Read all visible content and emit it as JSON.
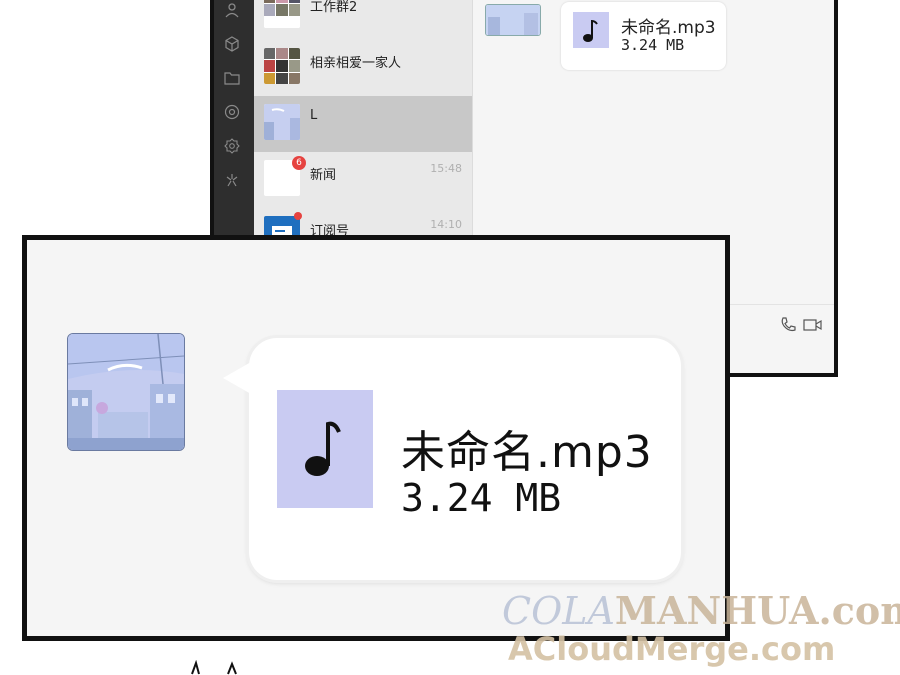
{
  "chat_list": [
    {
      "name": "工作群2",
      "time": "",
      "badge": ""
    },
    {
      "name": "相亲相爱一家人",
      "time": "",
      "badge": ""
    },
    {
      "name": "L",
      "time": "",
      "badge": "",
      "selected": true
    },
    {
      "name": "新闻",
      "time": "15:48",
      "badge": "6"
    },
    {
      "name": "订阅号",
      "time": "14:10",
      "badge": ""
    }
  ],
  "rail_icons": [
    "contacts-icon",
    "cube-icon",
    "folder-icon",
    "aperture-icon",
    "settings-icon",
    "sparkle-icon"
  ],
  "message": {
    "file_name": "未命名.mp3",
    "file_size": "3.24 MB",
    "file_icon": "music-note-icon"
  },
  "pane_tools": [
    "phone-icon",
    "video-call-icon"
  ],
  "watermark": {
    "line1_a": "COLA",
    "line1_b": "MANHUA.com",
    "line2": "ACloudMerge.com"
  },
  "colors": {
    "rail": "#2e2e2e",
    "list_bg": "#e9e9e9",
    "selected": "#c8c8c8",
    "file_icon": "#c9cbf2",
    "badge": "#e64340"
  }
}
